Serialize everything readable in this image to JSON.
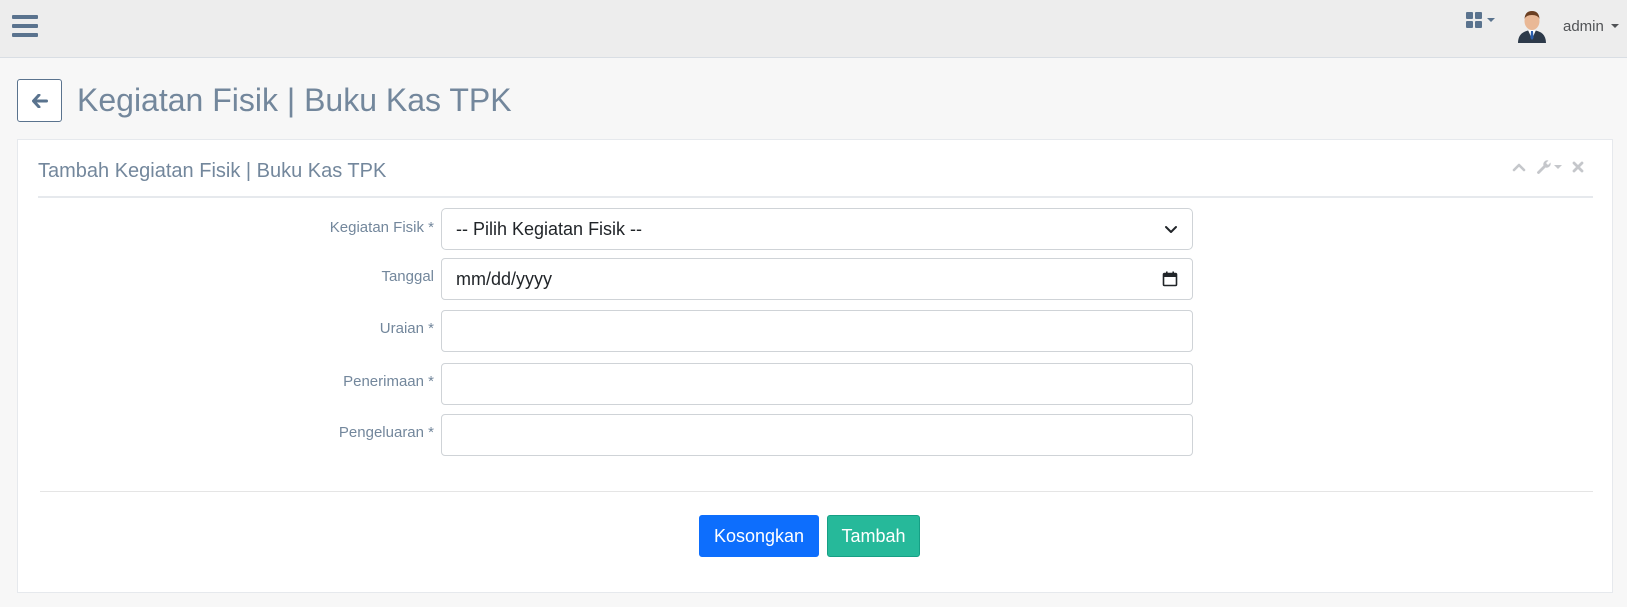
{
  "topbar": {
    "menu_icon": "hamburger-icon",
    "apps_icon": "grid-icon",
    "user": {
      "name": "admin",
      "avatar": "user-avatar"
    }
  },
  "page": {
    "back_icon": "arrow-left-icon",
    "title": "Kegiatan Fisik | Buku Kas TPK"
  },
  "panel": {
    "title": "Tambah Kegiatan Fisik | Buku Kas TPK",
    "tools": [
      "chevron-up-icon",
      "wrench-icon",
      "close-icon"
    ]
  },
  "form": {
    "kegiatan_fisik": {
      "label": "Kegiatan Fisik *",
      "selected": "-- Pilih Kegiatan Fisik --"
    },
    "tanggal": {
      "label": "Tanggal",
      "placeholder": "mm/dd/yyyy"
    },
    "uraian": {
      "label": "Uraian *",
      "value": ""
    },
    "penerimaan": {
      "label": "Penerimaan *",
      "value": ""
    },
    "pengeluaran": {
      "label": "Pengeluaran *",
      "value": ""
    }
  },
  "buttons": {
    "reset_label": "Kosongkan",
    "submit_label": "Tambah"
  },
  "colors": {
    "primary": "#0d6efd",
    "success": "#26B99A",
    "text": "#73879C",
    "icon": "#5A738E"
  }
}
